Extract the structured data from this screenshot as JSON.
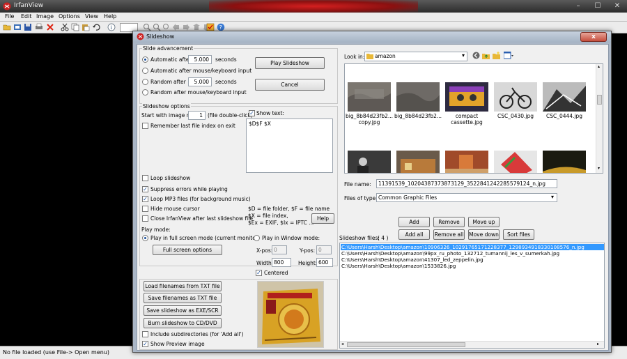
{
  "app": {
    "title": "IrfanView",
    "menu": [
      "File",
      "Edit",
      "Image",
      "Options",
      "View",
      "Help"
    ],
    "status": "No file loaded (use File-> Open menu)"
  },
  "dialog": {
    "title": "Slideshow",
    "close": "x",
    "advancement": {
      "group_label": "Slide advancement",
      "auto_label": "Automatic after",
      "auto_value": "5.000",
      "seconds": "seconds",
      "auto_mouse_label": "Automatic after mouse/keyboard input",
      "random_label": "Random",
      "after_label": "after",
      "random_value": "5.000",
      "random_mouse_label": "Random   after mouse/keyboard input"
    },
    "play_button": "Play Slideshow",
    "cancel_button": "Cancel",
    "options": {
      "group_label": "Slideshow options",
      "start_label": "Start with image nr.:",
      "start_value": "1",
      "file_dblclick": "(file double-click)",
      "remember_label": "Remember last file index on exit",
      "show_text_label": "Show text:",
      "show_text_value": "$D$F $X",
      "loop_label": "Loop slideshow",
      "suppress_label": "Suppress errors while playing",
      "loop_mp3_label": "Loop MP3 files (for background music)",
      "hide_mouse_label": "Hide mouse cursor",
      "close_after_label": "Close IrfanView after last slideshow file",
      "help_line1": "$D = file folder, $F = file name",
      "help_line2": "$X = file index,",
      "help_line3": "$Ex = EXIF, $Ix = IPTC ...",
      "help_button": "Help"
    },
    "play_mode": {
      "group_label": "Play mode:",
      "fullscreen_label": "Play in full screen mode (current monitor)",
      "fullscreen_options": "Full screen options",
      "window_label": "Play in Window mode:",
      "xpos_label": "X-pos:",
      "xpos_value": "0",
      "ypos_label": "Y-pos:",
      "ypos_value": "0",
      "width_label": "Width:",
      "width_value": "800",
      "height_label": "Height:",
      "height_value": "600",
      "centered_label": "Centered"
    },
    "bottom_buttons": {
      "load_txt": "Load filenames from TXT file",
      "save_txt": "Save filenames as TXT file",
      "save_exe": "Save slideshow as  EXE/SCR",
      "burn_cd": "Burn slideshow to CD/DVD",
      "include_sub": "Include subdirectories (for 'Add all')",
      "show_preview": "Show Preview image"
    },
    "browser": {
      "look_in_label": "Look in:",
      "look_in_value": "amazon",
      "thumbnails": [
        {
          "caption": "big_8b84d23fb2...",
          "caption2": "copy.jpg"
        },
        {
          "caption": "big_8b84d23fb2...",
          "caption2": ""
        },
        {
          "caption": "compact",
          "caption2": "cassette.jpg"
        },
        {
          "caption": "CSC_0430.jpg",
          "caption2": ""
        },
        {
          "caption": "CSC_0444.jpg",
          "caption2": ""
        }
      ],
      "file_name_label": "File name:",
      "file_name_value": "11391539_10204387373873129_3522841242285579124_n.jpg",
      "file_type_label": "Files of type:",
      "file_type_value": "Common Graphic Files"
    },
    "list_buttons": {
      "add": "Add",
      "remove": "Remove",
      "move_up": "Move up",
      "add_all": "Add all",
      "remove_all": "Remove all",
      "move_down": "Move down",
      "sort_files": "Sort files"
    },
    "slideshow_files": {
      "label": "Slideshow files:",
      "count": "( 4 )",
      "files": [
        "C:\\Users\\Harsh\\Desktop\\amazon\\10906326_10291765171228377_1298934918330108576_n.jpg",
        "C:\\Users\\Harsh\\Desktop\\amazon\\99px_ru_photo_132712_tumannij_les_v_sumerkah.jpg",
        "C:\\Users\\Harsh\\Desktop\\amazon\\41307_led_zeppelin.jpg",
        "C:\\Users\\Harsh\\Desktop\\amazon\\1533826.jpg"
      ]
    },
    "colors": {
      "selection": "#3399ff",
      "dialog_frame": "#aab6c6"
    }
  }
}
